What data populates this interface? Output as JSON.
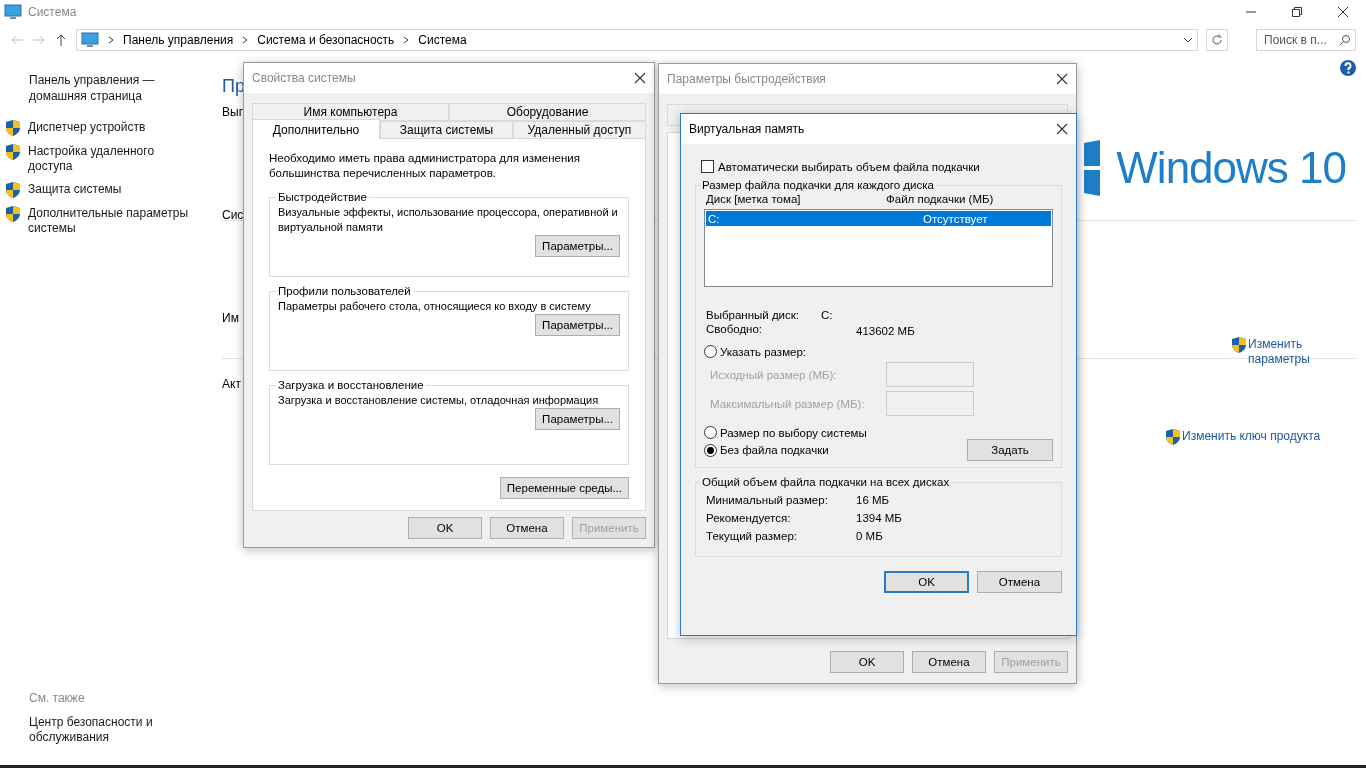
{
  "window": {
    "title": "Система"
  },
  "address_bar": {
    "breadcrumbs": [
      "Панель управления",
      "Система и безопасность",
      "Система"
    ]
  },
  "search": {
    "placeholder": "Поиск в п..."
  },
  "sidebar": {
    "home_link": "Панель управления — домашняя страница",
    "items": [
      {
        "label": "Диспетчер устройств"
      },
      {
        "label": "Настройка удаленного доступа"
      },
      {
        "label": "Защита системы"
      },
      {
        "label": "Дополнительные параметры системы"
      }
    ],
    "see_also_title": "См. также",
    "see_also": [
      "Центр безопасности и обслуживания"
    ]
  },
  "content": {
    "heading": "Пр",
    "section_labels": [
      "Вып",
      "Сис",
      "Им",
      "Акт"
    ],
    "logo_text": "Windows 10",
    "links": [
      {
        "label": "Изменить параметры"
      },
      {
        "label": "Изменить ключ продукта"
      }
    ]
  },
  "system_properties": {
    "title": "Свойства системы",
    "tab_rows": [
      [
        {
          "label": "Имя компьютера",
          "selected": false
        },
        {
          "label": "Оборудование",
          "selected": false
        }
      ],
      [
        {
          "label": "Дополнительно",
          "selected": true
        },
        {
          "label": "Защита системы",
          "selected": false
        },
        {
          "label": "Удаленный доступ",
          "selected": false
        }
      ]
    ],
    "note": "Необходимо иметь права администратора для изменения большинства перечисленных параметров.",
    "groups": [
      {
        "title": "Быстродействие",
        "text": "Визуальные эффекты, использование процессора, оперативной и виртуальной памяти",
        "button": "Параметры..."
      },
      {
        "title": "Профили пользователей",
        "text": "Параметры рабочего стола, относящиеся ко входу в систему",
        "button": "Параметры..."
      },
      {
        "title": "Загрузка и восстановление",
        "text": "Загрузка и восстановление системы, отладочная информация",
        "button": "Параметры..."
      }
    ],
    "env_button": "Переменные среды...",
    "buttons": [
      {
        "label": "OK",
        "disabled": false
      },
      {
        "label": "Отмена",
        "disabled": false
      },
      {
        "label": "Применить",
        "disabled": true
      }
    ]
  },
  "performance_options": {
    "title": "Параметры быстродействия",
    "buttons": [
      {
        "label": "OK",
        "disabled": false
      },
      {
        "label": "Отмена",
        "disabled": false
      },
      {
        "label": "Применить",
        "disabled": true
      }
    ]
  },
  "virtual_memory": {
    "title": "Виртуальная память",
    "auto_checkbox": {
      "label": "Автоматически выбирать объем файла подкачки",
      "checked": false
    },
    "per_disk": {
      "title": "Размер файла подкачки для каждого диска",
      "columns": [
        "Диск [метка тома]",
        "Файл подкачки (МБ)"
      ],
      "rows": [
        {
          "drive": "C:",
          "size": "Отсутствует",
          "selected": true
        }
      ],
      "selected_drive_label": "Выбранный диск:",
      "selected_drive": "C:",
      "free_label": "Свободно:",
      "free": "413602 МБ",
      "options": [
        {
          "label": "Указать размер:",
          "selected": false
        },
        {
          "label": "Размер по выбору системы",
          "selected": false
        },
        {
          "label": "Без файла подкачки",
          "selected": true
        }
      ],
      "initial_label": "Исходный размер (МБ):",
      "max_label": "Максимальный размер (МБ):",
      "set_button": "Задать"
    },
    "totals": {
      "title": "Общий объем файла подкачки на всех дисках",
      "rows": [
        {
          "label": "Минимальный размер:",
          "value": "16 МБ"
        },
        {
          "label": "Рекомендуется:",
          "value": "1394 МБ"
        },
        {
          "label": "Текущий размер:",
          "value": "0 МБ"
        }
      ]
    },
    "buttons": [
      {
        "label": "OK",
        "default": true
      },
      {
        "label": "Отмена",
        "default": false
      }
    ]
  }
}
